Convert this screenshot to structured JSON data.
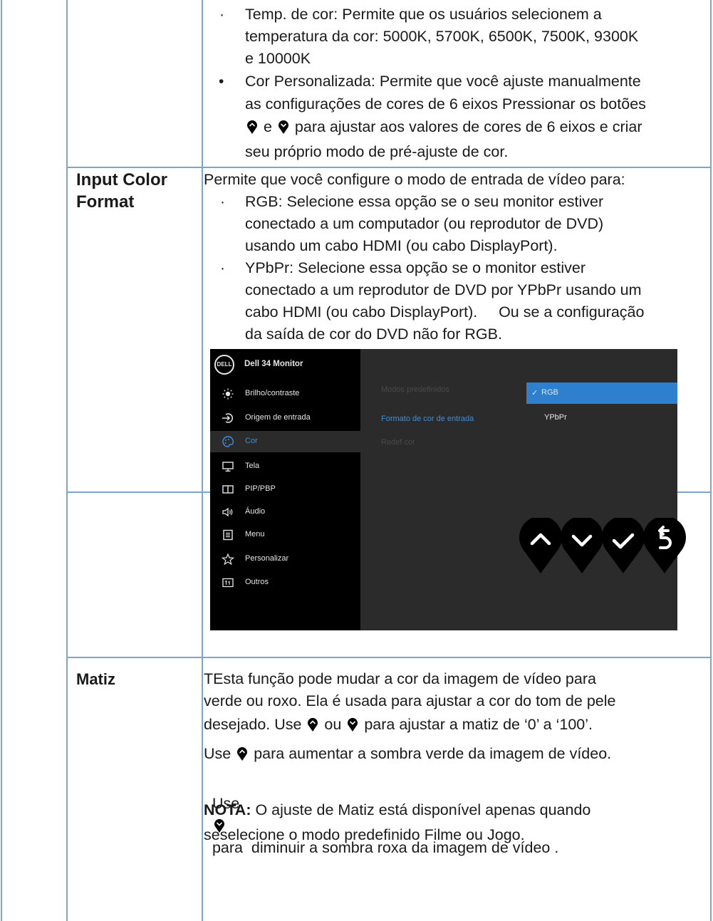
{
  "rows": [
    {
      "content": {
        "items": [
          {
            "bullet": "·",
            "term": "Temp. de cor",
            "sep": ":",
            "lines": [
              "Permite que os usuários selecionem a",
              "temperatura da cor: 5000K, 5700K, 6500K, 7500K, 9300K",
              "e 10000K"
            ]
          },
          {
            "bullet": "•",
            "term": "Cor Personalizada",
            "sep": ":",
            "lines": [
              "Permite que você ajuste manualmente",
              "as configurações de cores de 6 eixos Pressionar os botões"
            ],
            "line3_mid": "e",
            "line3_end": "para ajustar aos valores de cores de 6 eixos e criar",
            "line4": "seu próprio modo de pré-ajuste de cor."
          }
        ]
      }
    },
    {
      "label_lines": [
        "Input Color",
        "Format"
      ],
      "intro": "Permite que você configure o modo de entrada de vídeo para:",
      "items": [
        {
          "bullet": "·",
          "term": "RGB:",
          "lines": [
            "Selecione essa opção se o seu monitor estiver",
            "conectado a um computador (ou reprodutor de DVD)",
            "usando um cabo HDMI (ou cabo DisplayPort)."
          ]
        },
        {
          "bullet": "·",
          "term": "YPbPr:",
          "lines": [
            "Selecione essa opção se o monitor estiver",
            "conectado a um reprodutor de DVD por YPbPr usando um",
            "cabo HDMI (ou cabo DisplayPort).     Ou se a configuração",
            "da saída de cor do DVD não for RGB."
          ]
        }
      ]
    },
    {
      "label": "Matiz",
      "lines": [
        "TEsta função pode mudar a cor da imagem de vídeo para",
        "verde ou roxo. Ela é usada para ajustar a cor do tom de pele"
      ],
      "line3_start": "desejado. Use",
      "line3_mid": "ou",
      "line3_end": "para ajustar a matiz de ‘0’ a ‘100’.",
      "line4_start": "Use",
      "line4_end": "para aumentar a sombra verde da imagem de vídeo.",
      "line5_start": "Use",
      "line5_end": "para  diminuir a sombra roxa da imagem de vídeo .",
      "note_label": "NOTA:",
      "note_lines": [
        "O ajuste de Matiz está disponível apenas quando",
        "seselecione o modo predefinido Filme ou Jogo."
      ]
    }
  ],
  "osd": {
    "logo": "DELL",
    "title": "Dell  34 Monitor",
    "menu": [
      {
        "icon": "brightness-icon",
        "label": "Brilho/contraste"
      },
      {
        "icon": "input-source-icon",
        "label": "Origem de entrada"
      },
      {
        "icon": "color-palette-icon",
        "label": "Cor",
        "selected": true
      },
      {
        "icon": "display-icon",
        "label": "Tela"
      },
      {
        "icon": "pip-icon",
        "label": "PIP/PBP"
      },
      {
        "icon": "audio-icon",
        "label": "Áudio"
      },
      {
        "icon": "menu-icon",
        "label": "Menu"
      },
      {
        "icon": "star-icon",
        "label": "Personalizar"
      },
      {
        "icon": "others-icon",
        "label": "Outros"
      }
    ],
    "submenu": [
      {
        "label": "Modos predefinidos",
        "state": "disabled"
      },
      {
        "label": "Formato de cor de entrada",
        "state": "active"
      },
      {
        "label": "Redef cor",
        "state": "disabled"
      }
    ],
    "options": [
      {
        "check": "✓",
        "label": "RGB",
        "selected": true
      },
      {
        "label": "YPbPr"
      }
    ],
    "buttons": [
      "up-button-icon",
      "down-button-icon",
      "confirm-button-icon",
      "back-button-icon"
    ]
  },
  "colors": {
    "border": "#7aa6d6",
    "osd_highlight": "#2f7fcf",
    "osd_active_text": "#3d8fe0"
  }
}
